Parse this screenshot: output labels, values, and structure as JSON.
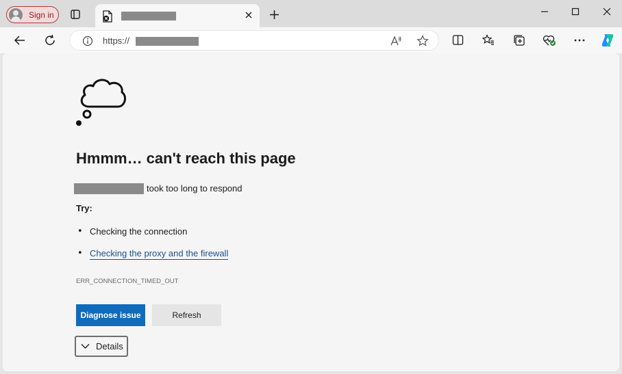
{
  "browser": {
    "sign_in_label": "Sign in",
    "tab": {
      "favicon": "error-page-icon",
      "close_icon": "close-icon"
    },
    "new_tab_icon": "plus-icon",
    "window_controls": [
      "minimize-icon",
      "maximize-icon",
      "close-icon"
    ],
    "address_bar": {
      "info_icon": "info-icon",
      "url_prefix": "https://"
    },
    "toolbar_icons": [
      "back-icon",
      "refresh-icon",
      "read-aloud-icon",
      "favorite-star-icon",
      "split-screen-icon",
      "favorites-icon",
      "collections-icon",
      "browser-essentials-icon",
      "more-icon",
      "copilot-icon"
    ]
  },
  "error_page": {
    "illustration": "thought-cloud-icon",
    "heading": "Hmmm… can't reach this page",
    "message": "took too long to respond",
    "try_label": "Try:",
    "suggestions": [
      {
        "text": "Checking the connection",
        "link": false
      },
      {
        "text": "Checking the proxy and the firewall",
        "link": true
      }
    ],
    "error_code": "ERR_CONNECTION_TIMED_OUT",
    "primary_button": "Diagnose issue",
    "secondary_button": "Refresh",
    "details_label": "Details"
  },
  "colors": {
    "primary_button": "#0f6cbd",
    "link": "#1d4f8a",
    "sign_in_border": "#b23b3b",
    "copilot_accent": "#1e90ff"
  }
}
